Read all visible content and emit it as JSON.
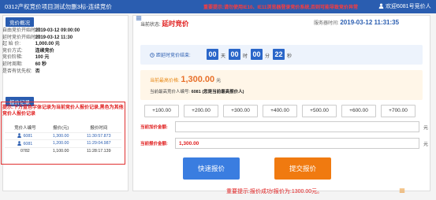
{
  "header": {
    "title": "0312产权竞价项目测试勿删3标-连续竞价",
    "notice": "重要提示:请勿使用IE10、IE11浏览器登录竞价系统,否则可能导致竞价异常",
    "welcome": "欢迎6081号竞价人"
  },
  "left": {
    "overview_label": "竞价概况",
    "info": [
      {
        "key": "自由竞价开始时间:",
        "value": "2019-03-12 09:00:00"
      },
      {
        "key": "延时竞价开始时间:",
        "value": "2019-03-12 11:30"
      },
      {
        "key": "起 始 价:",
        "value": "1,000.00 元"
      },
      {
        "key": "竞价方式:",
        "value": "连续竞价"
      },
      {
        "key": "竞价阶梯:",
        "value": "100 元"
      },
      {
        "key": "延时周期:",
        "value": "60 秒"
      },
      {
        "key": "是否有优先权:",
        "value": "否"
      }
    ],
    "records_label": "报价记录",
    "hint": "提示:下方蓝色字体记录为当前竞价人报价记录,黑色为其他竞价人报价记录",
    "records_headers": [
      "竞价人编号",
      "报价(元)",
      "报价时间"
    ],
    "records": [
      {
        "bidder": "6081",
        "price": "1,300.00",
        "time": "11:30:57.873",
        "mine": true
      },
      {
        "bidder": "6081",
        "price": "1,200.00",
        "time": "11:29:04.987",
        "mine": true
      },
      {
        "bidder": "0782",
        "price": "1,100.00",
        "time": "11:28:17.139",
        "mine": false
      }
    ]
  },
  "main": {
    "status_label": "当前状态:",
    "status_value": "延时竞价",
    "server_time_label": "服务器时间:",
    "server_time_value": "2019-03-12 11:31:35",
    "countdown_label": "距延时竞价结束:",
    "countdown": {
      "days": "00",
      "days_unit": "天",
      "hours": "00",
      "hours_unit": "时",
      "minutes": "00",
      "minutes_unit": "分",
      "seconds": "22",
      "seconds_unit": "秒"
    },
    "highest_label": "当前最高价格:",
    "highest_value": "1,300.00",
    "highest_unit": "元",
    "highest_bidder_label": "当前最高竞价人编号:",
    "highest_bidder_value": "6081 (您是当前最高报价人)",
    "increments": [
      "+100.00",
      "+200.00",
      "+300.00",
      "+400.00",
      "+500.00",
      "+600.00",
      "+700.00"
    ],
    "increase_label": "当前加价金额:",
    "increase_value": "",
    "bid_label": "当前报价金额:",
    "bid_value": "1,300.00",
    "unit": "元",
    "quick_button": "快速报价",
    "submit_button": "提交报价",
    "bottom_notice": "重要提示:报价成功!报价为:1300.00元。"
  },
  "colors": {
    "primary": "#2a5db0",
    "alert": "#e01e1e",
    "orange": "#f07a10"
  }
}
